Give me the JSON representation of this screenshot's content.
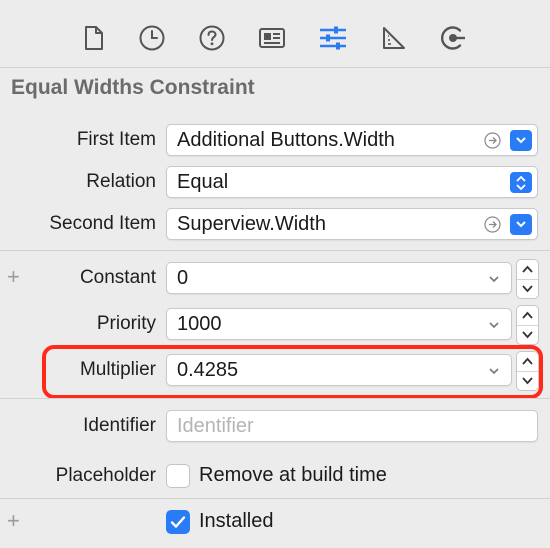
{
  "toolbar": {
    "icons": [
      "file-inspector-icon",
      "history-inspector-icon",
      "quick-help-icon",
      "identity-inspector-icon",
      "attributes-inspector-icon",
      "size-inspector-icon",
      "connections-inspector-icon"
    ],
    "active": "attributes-inspector-icon",
    "accent": "#2a7cf6"
  },
  "section_title": "Equal Widths Constraint",
  "rows": {
    "first_item": {
      "label": "First Item",
      "value": "Additional Buttons.Width"
    },
    "relation": {
      "label": "Relation",
      "value": "Equal"
    },
    "second_item": {
      "label": "Second Item",
      "value": "Superview.Width"
    },
    "constant": {
      "label": "Constant",
      "value": "0"
    },
    "priority": {
      "label": "Priority",
      "value": "1000"
    },
    "multiplier": {
      "label": "Multiplier",
      "value": "0.4285"
    },
    "identifier": {
      "label": "Identifier",
      "placeholder": "Identifier"
    },
    "placeholder": {
      "label": "Placeholder",
      "checkbox_label": "Remove at build time",
      "checked": false
    },
    "installed": {
      "checkbox_label": "Installed",
      "checked": true
    }
  },
  "plus_glyph": "+",
  "highlight_color": "#ff2a1a"
}
